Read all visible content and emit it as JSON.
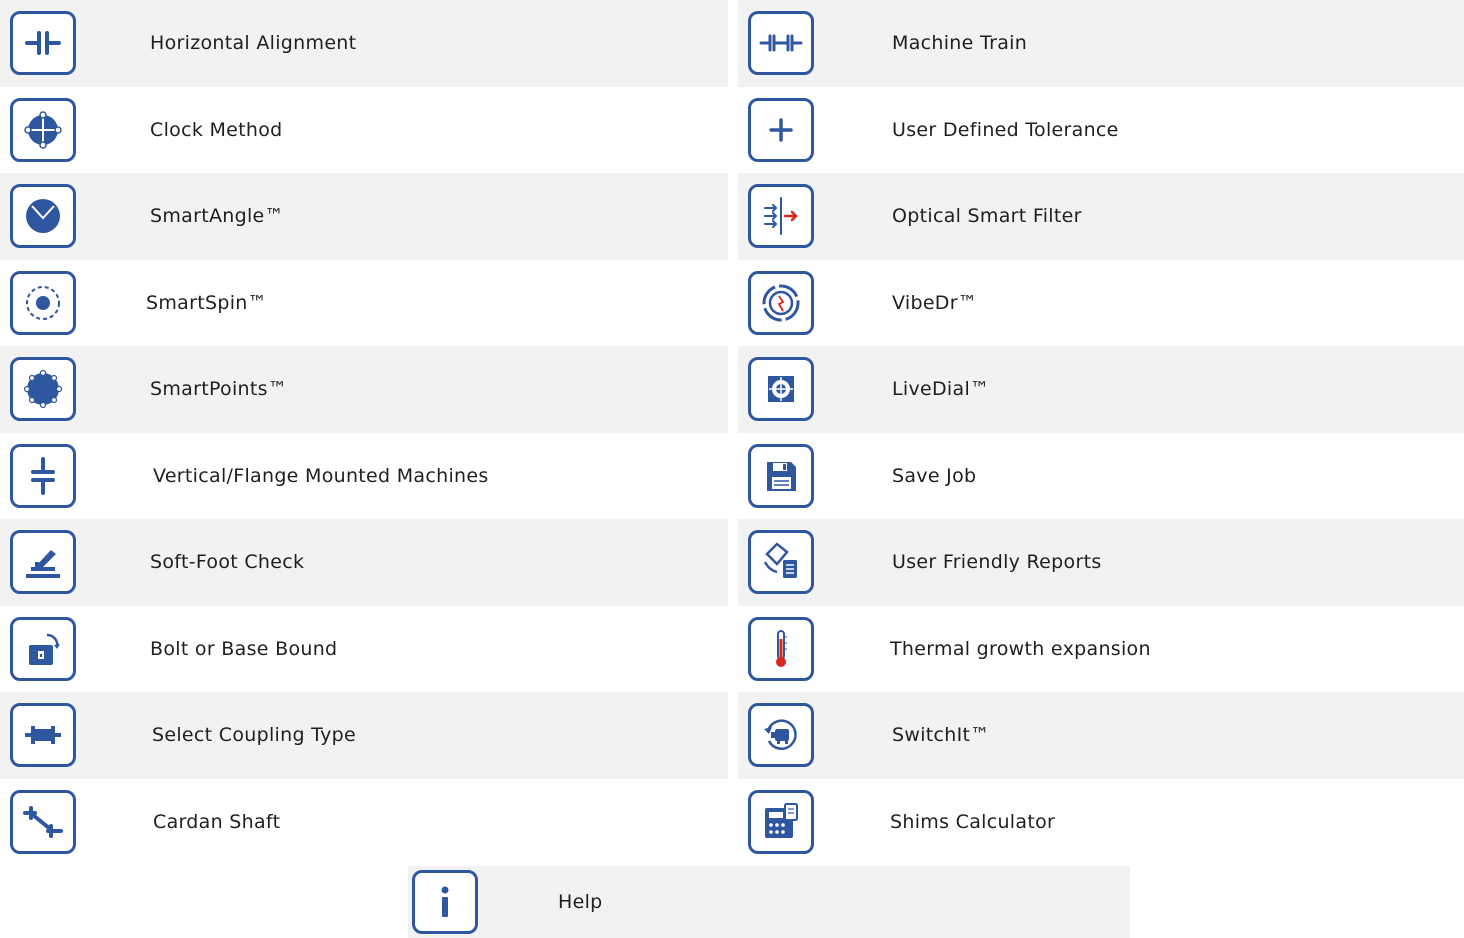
{
  "colors": {
    "accent": "#2f57a0",
    "row_shade": "#f2f2f2",
    "red": "#d9261c"
  },
  "left_items": [
    {
      "label": "Horizontal Alignment",
      "icon": "horizontal-alignment-icon"
    },
    {
      "label": "Clock Method",
      "icon": "clock-method-icon"
    },
    {
      "label": "SmartAngle™",
      "icon": "smartangle-icon"
    },
    {
      "label": "SmartSpin™",
      "icon": "smartspin-icon"
    },
    {
      "label": "SmartPoints™",
      "icon": "smartpoints-icon"
    },
    {
      "label": "Vertical/Flange Mounted Machines",
      "icon": "vertical-flange-icon"
    },
    {
      "label": "Soft-Foot Check",
      "icon": "soft-foot-icon"
    },
    {
      "label": "Bolt or Base Bound",
      "icon": "bolt-base-bound-icon"
    },
    {
      "label": "Select Coupling Type",
      "icon": "coupling-type-icon"
    },
    {
      "label": "Cardan Shaft",
      "icon": "cardan-shaft-icon"
    }
  ],
  "right_items": [
    {
      "label": "Machine Train",
      "icon": "machine-train-icon"
    },
    {
      "label": "User Defined Tolerance",
      "icon": "plus-icon"
    },
    {
      "label": "Optical Smart Filter",
      "icon": "optical-filter-icon"
    },
    {
      "label": "VibeDr™",
      "icon": "vibedr-icon"
    },
    {
      "label": "LiveDial™",
      "icon": "livedial-icon"
    },
    {
      "label": "Save Job",
      "icon": "save-icon"
    },
    {
      "label": "User Friendly Reports",
      "icon": "reports-icon"
    },
    {
      "label": "Thermal growth expansion",
      "icon": "thermometer-icon"
    },
    {
      "label": "SwitchIt™",
      "icon": "switchit-icon"
    },
    {
      "label": "Shims Calculator",
      "icon": "calculator-icon"
    }
  ],
  "help": {
    "label": "Help",
    "icon": "info-icon"
  }
}
